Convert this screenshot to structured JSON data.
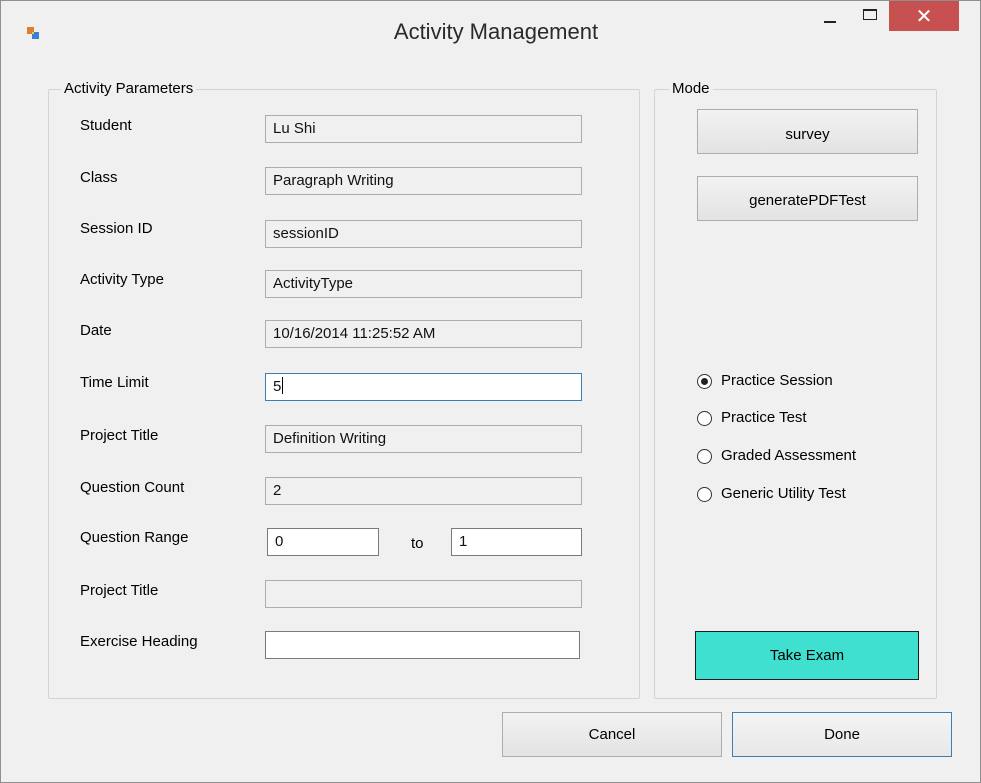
{
  "window": {
    "title": "Activity Management"
  },
  "params_group": {
    "legend": "Activity Parameters",
    "fields": [
      {
        "label": "Student",
        "value": "Lu Shi"
      },
      {
        "label": "Class",
        "value": "Paragraph Writing"
      },
      {
        "label": "Session ID",
        "value": "sessionID"
      },
      {
        "label": "Activity Type",
        "value": "ActivityType"
      },
      {
        "label": "Date",
        "value": "10/16/2014 11:25:52 AM"
      },
      {
        "label": "Time Limit",
        "value": "5"
      },
      {
        "label": "Project Title",
        "value": "Definition Writing"
      },
      {
        "label": "Question Count",
        "value": "2"
      },
      {
        "label": "Question Range",
        "value": "0",
        "to_label": "to",
        "to_value": "1"
      },
      {
        "label": "Project Title",
        "value": ""
      },
      {
        "label": "Exercise Heading",
        "value": ""
      }
    ]
  },
  "mode_group": {
    "legend": "Mode",
    "buttons": {
      "survey": "survey",
      "generate_pdf": "generatePDFTest",
      "take_exam": "Take Exam"
    },
    "radios": [
      {
        "label": "Practice Session",
        "checked": true
      },
      {
        "label": "Practice Test",
        "checked": false
      },
      {
        "label": "Graded Assessment",
        "checked": false
      },
      {
        "label": "Generic Utility Test",
        "checked": false
      }
    ]
  },
  "footer": {
    "cancel": "Cancel",
    "done": "Done"
  },
  "colors": {
    "take_exam_bg": "#40e0d0",
    "close_button_bg": "#c75050",
    "focus_border": "#3c7fb1"
  },
  "icons": {
    "app": "app-icon",
    "minimize": "minimize-icon",
    "maximize": "maximize-icon",
    "close": "close-icon"
  }
}
